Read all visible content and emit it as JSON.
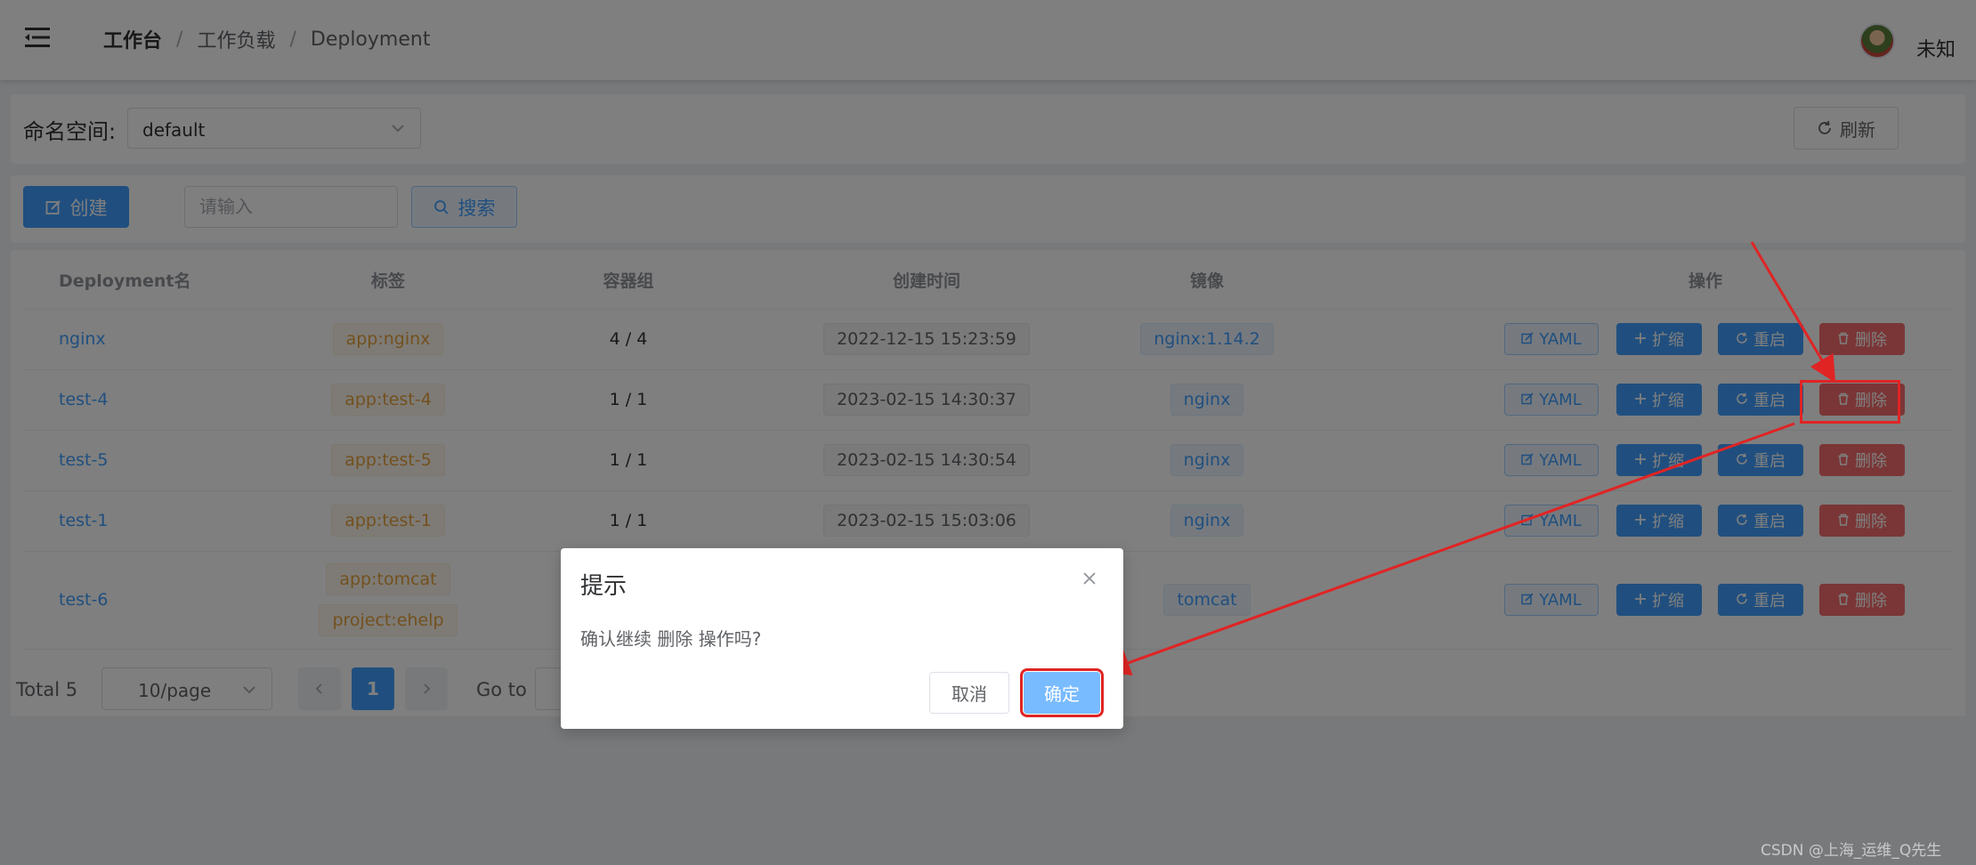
{
  "header": {
    "menu_icon": "menu-fold-icon",
    "breadcrumb": [
      "工作台",
      "工作负载",
      "Deployment"
    ],
    "separator": "/",
    "username": "未知"
  },
  "namespace": {
    "label": "命名空间:",
    "selected": "default",
    "refresh_label": "刷新"
  },
  "toolbar": {
    "create_label": "创建",
    "search_placeholder": "请输入",
    "search_label": "搜索"
  },
  "table": {
    "columns": [
      "Deployment名",
      "标签",
      "容器组",
      "创建时间",
      "镜像",
      "操作"
    ],
    "rows": [
      {
        "name": "nginx",
        "labels": [
          "app:nginx"
        ],
        "pods": "4 / 4",
        "created": "2022-12-15 15:23:59",
        "image": "nginx:1.14.2"
      },
      {
        "name": "test-4",
        "labels": [
          "app:test-4"
        ],
        "pods": "1 / 1",
        "created": "2023-02-15 14:30:37",
        "image": "nginx"
      },
      {
        "name": "test-5",
        "labels": [
          "app:test-5"
        ],
        "pods": "1 / 1",
        "created": "2023-02-15 14:30:54",
        "image": "nginx"
      },
      {
        "name": "test-1",
        "labels": [
          "app:test-1"
        ],
        "pods": "1 / 1",
        "created": "2023-02-15 15:03:06",
        "image": "nginx"
      },
      {
        "name": "test-6",
        "labels": [
          "app:tomcat",
          "project:ehelp"
        ],
        "pods": "",
        "created": "",
        "image": "tomcat"
      }
    ],
    "actions": {
      "yaml": "YAML",
      "scale": "扩缩",
      "restart": "重启",
      "delete": "删除"
    }
  },
  "pagination": {
    "total": "Total 5",
    "page_size": "10/page",
    "current_page": "1",
    "goto_label": "Go to"
  },
  "dialog": {
    "title": "提示",
    "message": "确认继续 删除 操作吗?",
    "cancel_label": "取消",
    "confirm_label": "确定"
  },
  "watermark": "CSDN @上海_运维_Q先生",
  "colors": {
    "primary": "#409eff",
    "danger": "#f56c6c",
    "warning": "#e6a23c",
    "annotation": "#e02424"
  }
}
